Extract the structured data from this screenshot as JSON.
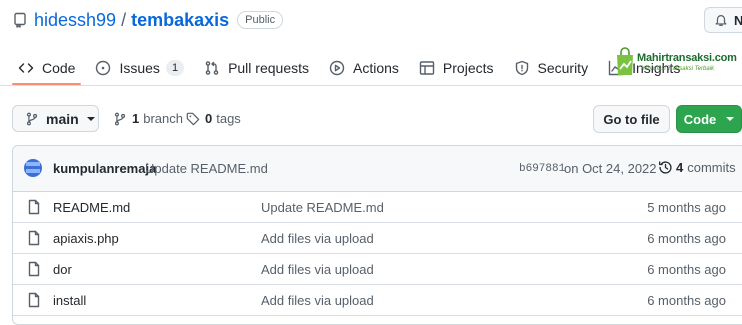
{
  "repo": {
    "owner": "hidessh99",
    "separator": "/",
    "name": "tembakaxis",
    "visibility": "Public"
  },
  "notifications": {
    "label": "N",
    "icon": "bell-icon"
  },
  "tabs": [
    {
      "label": "Code",
      "icon": "code-icon",
      "selected": true
    },
    {
      "label": "Issues",
      "icon": "issue-opened-icon",
      "count": "1"
    },
    {
      "label": "Pull requests",
      "icon": "git-pull-request-icon"
    },
    {
      "label": "Actions",
      "icon": "play-icon"
    },
    {
      "label": "Projects",
      "icon": "table-icon"
    },
    {
      "label": "Security",
      "icon": "shield-icon"
    },
    {
      "label": "Insights",
      "icon": "graph-icon"
    }
  ],
  "watermark": {
    "title": "Mahirtransaksi.com",
    "subtitle": "Informasi Transaksi Terbaik"
  },
  "branch": {
    "current": "main",
    "branches_count": "1",
    "branches_label": "branch",
    "tags_count": "0",
    "tags_label": "tags"
  },
  "actions": {
    "goto_file": "Go to file",
    "code": "Code"
  },
  "latest_commit": {
    "author": "kumpulanremaja",
    "message": "Update README.md",
    "sha": "b697881",
    "date": "on Oct 24, 2022",
    "commits_count": "4",
    "commits_label": "commits"
  },
  "files": [
    {
      "name": "README.md",
      "message": "Update README.md",
      "age": "5 months ago"
    },
    {
      "name": "apiaxis.php",
      "message": "Add files via upload",
      "age": "6 months ago"
    },
    {
      "name": "dor",
      "message": "Add files via upload",
      "age": "6 months ago"
    },
    {
      "name": "install",
      "message": "Add files via upload",
      "age": "6 months ago"
    }
  ],
  "colors": {
    "link": "#0969da",
    "primary_button": "#2da44e",
    "tab_underline": "#fd8c73",
    "watermark": "#1d6b2f"
  }
}
